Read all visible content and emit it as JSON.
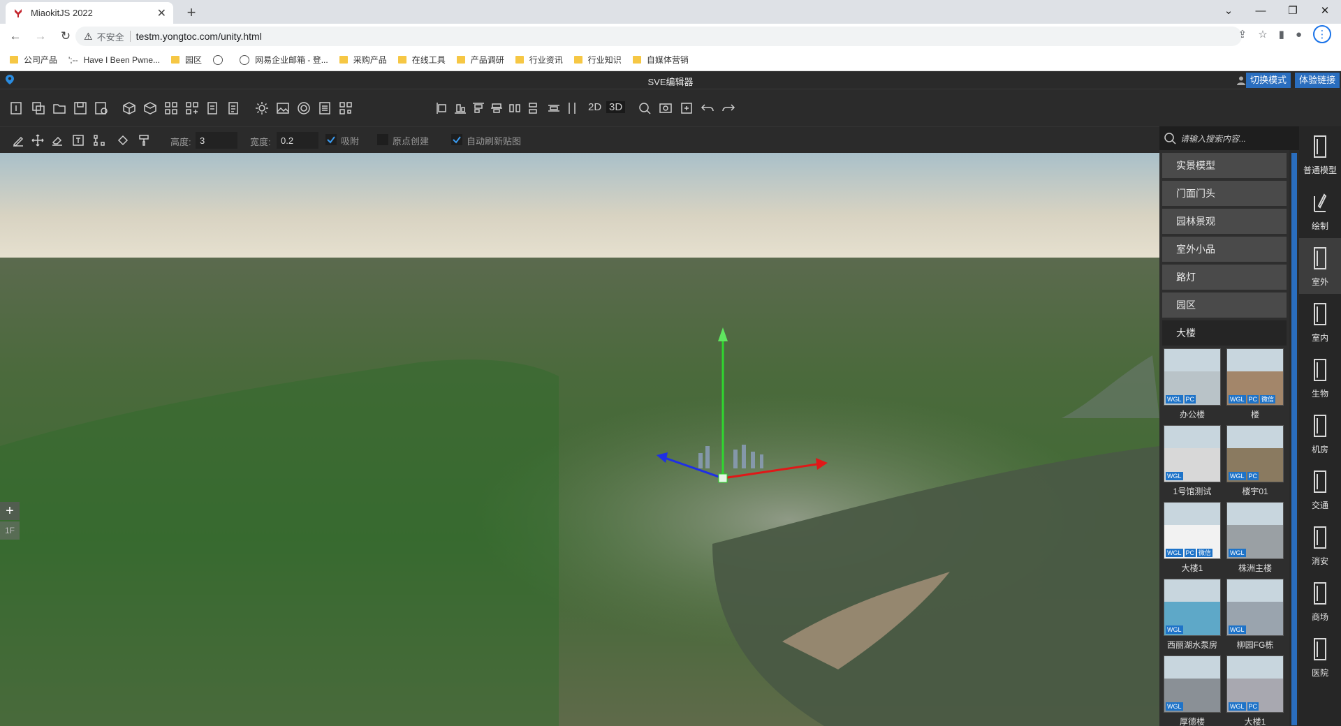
{
  "browser": {
    "tab_title": "MiaokitJS 2022",
    "url": "testm.yongtoc.com/unity.html",
    "insecure_label": "不安全",
    "bookmarks": [
      {
        "label": "公司产品",
        "icon": "folder"
      },
      {
        "label": "Have I Been Pwne...",
        "icon": "site"
      },
      {
        "label": "园区",
        "icon": "folder"
      },
      {
        "label": "",
        "icon": "globe"
      },
      {
        "label": "网易企业邮箱 - 登...",
        "icon": "globe"
      },
      {
        "label": "采购产品",
        "icon": "folder"
      },
      {
        "label": "在线工具",
        "icon": "folder"
      },
      {
        "label": "产品调研",
        "icon": "folder"
      },
      {
        "label": "行业资讯",
        "icon": "folder"
      },
      {
        "label": "行业知识",
        "icon": "folder"
      },
      {
        "label": "自媒体营销",
        "icon": "folder"
      }
    ]
  },
  "app": {
    "title": "SVE编辑器",
    "switch_mode": "切换模式",
    "experience_link": "体验链接",
    "toolbar": {
      "label_2d": "2D",
      "label_3d": "3D"
    },
    "edit_bar": {
      "height_label": "高度:",
      "height_value": "3",
      "width_label": "宽度:",
      "width_value": "0.2",
      "snap_label": "吸附",
      "snap_checked": true,
      "origin_label": "原点创建",
      "origin_checked": false,
      "auto_refresh_label": "自动刷新贴图",
      "auto_refresh_checked": true
    },
    "floor": {
      "plus": "+",
      "current": "1F"
    },
    "search": {
      "placeholder": "请输入搜索内容..."
    },
    "categories": [
      {
        "label": "实景模型",
        "active": false
      },
      {
        "label": "门面门头",
        "active": false
      },
      {
        "label": "园林景观",
        "active": false
      },
      {
        "label": "室外小品",
        "active": false
      },
      {
        "label": "路灯",
        "active": false
      },
      {
        "label": "园区",
        "active": false
      },
      {
        "label": "大楼",
        "active": true
      }
    ],
    "models": [
      {
        "name": "办公楼",
        "badges": [
          "WGL",
          "PC"
        ],
        "color": "#b9c3c8"
      },
      {
        "name": "楼",
        "badges": [
          "WGL",
          "PC",
          "微信"
        ],
        "color": "#a3866a"
      },
      {
        "name": "1号馆测试",
        "badges": [
          "WGL"
        ],
        "color": "#d8d8d8"
      },
      {
        "name": "楼宇01",
        "badges": [
          "WGL",
          "PC"
        ],
        "color": "#8a7a60"
      },
      {
        "name": "大楼1",
        "badges": [
          "WGL",
          "PC",
          "微信"
        ],
        "color": "#f2f2f2"
      },
      {
        "name": "株洲主楼",
        "badges": [
          "WGL"
        ],
        "color": "#9aa0a4"
      },
      {
        "name": "西丽湖水泵房",
        "badges": [
          "WGL"
        ],
        "color": "#5ea8c8"
      },
      {
        "name": "柳园FG栋",
        "badges": [
          "WGL"
        ],
        "color": "#9aa4ae"
      },
      {
        "name": "厚德楼",
        "badges": [
          "WGL"
        ],
        "color": "#8a9096"
      },
      {
        "name": "大楼1",
        "badges": [
          "WGL",
          "PC"
        ],
        "color": "#a8a8b0"
      }
    ],
    "right_nav": [
      {
        "label": "普通模型",
        "active": false
      },
      {
        "label": "绘制",
        "active": false
      },
      {
        "label": "室外",
        "active": true
      },
      {
        "label": "室内",
        "active": false
      },
      {
        "label": "生物",
        "active": false
      },
      {
        "label": "机房",
        "active": false
      },
      {
        "label": "交通",
        "active": false
      },
      {
        "label": "消安",
        "active": false
      },
      {
        "label": "商场",
        "active": false
      },
      {
        "label": "医院",
        "active": false
      }
    ]
  }
}
